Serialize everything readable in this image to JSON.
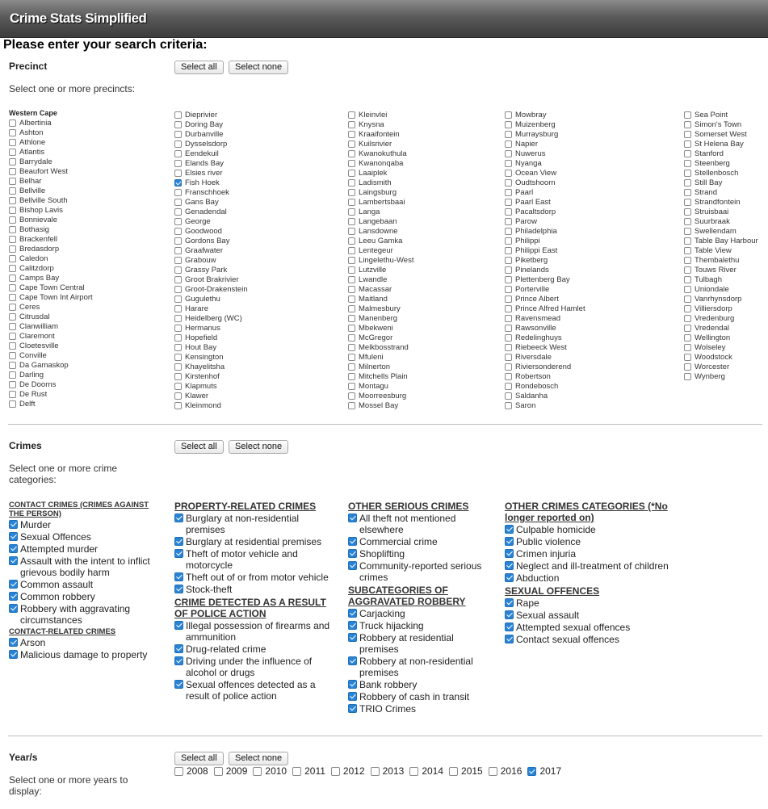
{
  "header": {
    "title": "Crime Stats Simplified"
  },
  "subtitle": "Please enter your search criteria:",
  "precinct": {
    "label": "Precinct",
    "select_all": "Select all",
    "select_none": "Select none",
    "description": "Select one or more precincts:",
    "group_title": "Western Cape",
    "columns": [
      [
        {
          "name": "Albertinia",
          "checked": false
        },
        {
          "name": "Ashton",
          "checked": false
        },
        {
          "name": "Athlone",
          "checked": false
        },
        {
          "name": "Atlantis",
          "checked": false
        },
        {
          "name": "Barrydale",
          "checked": false
        },
        {
          "name": "Beaufort West",
          "checked": false
        },
        {
          "name": "Belhar",
          "checked": false
        },
        {
          "name": "Bellville",
          "checked": false
        },
        {
          "name": "Bellville South",
          "checked": false
        },
        {
          "name": "Bishop Lavis",
          "checked": false
        },
        {
          "name": "Bonnievale",
          "checked": false
        },
        {
          "name": "Bothasig",
          "checked": false
        },
        {
          "name": "Brackenfell",
          "checked": false
        },
        {
          "name": "Bredasdorp",
          "checked": false
        },
        {
          "name": "Caledon",
          "checked": false
        },
        {
          "name": "Calitzdorp",
          "checked": false
        },
        {
          "name": "Camps Bay",
          "checked": false
        },
        {
          "name": "Cape Town Central",
          "checked": false
        },
        {
          "name": "Cape Town Int Airport",
          "checked": false
        },
        {
          "name": "Ceres",
          "checked": false
        },
        {
          "name": "Citrusdal",
          "checked": false
        },
        {
          "name": "Clanwilliam",
          "checked": false
        },
        {
          "name": "Claremont",
          "checked": false
        },
        {
          "name": "Cloetesville",
          "checked": false
        },
        {
          "name": "Conville",
          "checked": false
        },
        {
          "name": "Da Gamaskop",
          "checked": false
        },
        {
          "name": "Darling",
          "checked": false
        },
        {
          "name": "De Doorns",
          "checked": false
        },
        {
          "name": "De Rust",
          "checked": false
        },
        {
          "name": "Delft",
          "checked": false
        }
      ],
      [
        {
          "name": "Dieprivier",
          "checked": false
        },
        {
          "name": "Doring Bay",
          "checked": false
        },
        {
          "name": "Durbanville",
          "checked": false
        },
        {
          "name": "Dysselsdorp",
          "checked": false
        },
        {
          "name": "Eendekuil",
          "checked": false
        },
        {
          "name": "Elands Bay",
          "checked": false
        },
        {
          "name": "Elsies river",
          "checked": false
        },
        {
          "name": "Fish Hoek",
          "checked": true
        },
        {
          "name": "Franschhoek",
          "checked": false
        },
        {
          "name": "Gans Bay",
          "checked": false
        },
        {
          "name": "Genadendal",
          "checked": false
        },
        {
          "name": "George",
          "checked": false
        },
        {
          "name": "Goodwood",
          "checked": false
        },
        {
          "name": "Gordons Bay",
          "checked": false
        },
        {
          "name": "Graafwater",
          "checked": false
        },
        {
          "name": "Grabouw",
          "checked": false
        },
        {
          "name": "Grassy Park",
          "checked": false
        },
        {
          "name": "Groot Brakrivier",
          "checked": false
        },
        {
          "name": "Groot-Drakenstein",
          "checked": false
        },
        {
          "name": "Gugulethu",
          "checked": false
        },
        {
          "name": "Harare",
          "checked": false
        },
        {
          "name": "Heidelberg (WC)",
          "checked": false
        },
        {
          "name": "Hermanus",
          "checked": false
        },
        {
          "name": "Hopefield",
          "checked": false
        },
        {
          "name": "Hout Bay",
          "checked": false
        },
        {
          "name": "Kensington",
          "checked": false
        },
        {
          "name": "Khayelitsha",
          "checked": false
        },
        {
          "name": "Kirstenhof",
          "checked": false
        },
        {
          "name": "Klapmuts",
          "checked": false
        },
        {
          "name": "Klawer",
          "checked": false
        },
        {
          "name": "Kleinmond",
          "checked": false
        }
      ],
      [
        {
          "name": "Kleinvlei",
          "checked": false
        },
        {
          "name": "Knysna",
          "checked": false
        },
        {
          "name": "Kraaifontein",
          "checked": false
        },
        {
          "name": "Kuilsrivier",
          "checked": false
        },
        {
          "name": "Kwanokuthula",
          "checked": false
        },
        {
          "name": "Kwanonqaba",
          "checked": false
        },
        {
          "name": "Laaiplek",
          "checked": false
        },
        {
          "name": "Ladismith",
          "checked": false
        },
        {
          "name": "Laingsburg",
          "checked": false
        },
        {
          "name": "Lambertsbaai",
          "checked": false
        },
        {
          "name": "Langa",
          "checked": false
        },
        {
          "name": "Langebaan",
          "checked": false
        },
        {
          "name": "Lansdowne",
          "checked": false
        },
        {
          "name": "Leeu Gamka",
          "checked": false
        },
        {
          "name": "Lentegeur",
          "checked": false
        },
        {
          "name": "Lingelethu-West",
          "checked": false
        },
        {
          "name": "Lutzville",
          "checked": false
        },
        {
          "name": "Lwandle",
          "checked": false
        },
        {
          "name": "Macassar",
          "checked": false
        },
        {
          "name": "Maitland",
          "checked": false
        },
        {
          "name": "Malmesbury",
          "checked": false
        },
        {
          "name": "Manenberg",
          "checked": false
        },
        {
          "name": "Mbekweni",
          "checked": false
        },
        {
          "name": "McGregor",
          "checked": false
        },
        {
          "name": "Melkbosstrand",
          "checked": false
        },
        {
          "name": "Mfuleni",
          "checked": false
        },
        {
          "name": "Milnerton",
          "checked": false
        },
        {
          "name": "Mitchells Plain",
          "checked": false
        },
        {
          "name": "Montagu",
          "checked": false
        },
        {
          "name": "Moorreesburg",
          "checked": false
        },
        {
          "name": "Mossel Bay",
          "checked": false
        }
      ],
      [
        {
          "name": "Mowbray",
          "checked": false
        },
        {
          "name": "Muizenberg",
          "checked": false
        },
        {
          "name": "Murraysburg",
          "checked": false
        },
        {
          "name": "Napier",
          "checked": false
        },
        {
          "name": "Nuwerus",
          "checked": false
        },
        {
          "name": "Nyanga",
          "checked": false
        },
        {
          "name": "Ocean View",
          "checked": false
        },
        {
          "name": "Oudtshoorn",
          "checked": false
        },
        {
          "name": "Paarl",
          "checked": false
        },
        {
          "name": "Paarl East",
          "checked": false
        },
        {
          "name": "Pacaltsdorp",
          "checked": false
        },
        {
          "name": "Parow",
          "checked": false
        },
        {
          "name": "Philadelphia",
          "checked": false
        },
        {
          "name": "Philippi",
          "checked": false
        },
        {
          "name": "Philippi East",
          "checked": false
        },
        {
          "name": "Piketberg",
          "checked": false
        },
        {
          "name": "Pinelands",
          "checked": false
        },
        {
          "name": "Plettenberg Bay",
          "checked": false
        },
        {
          "name": "Porterville",
          "checked": false
        },
        {
          "name": "Prince Albert",
          "checked": false
        },
        {
          "name": "Prince Alfred Hamlet",
          "checked": false
        },
        {
          "name": "Ravensmead",
          "checked": false
        },
        {
          "name": "Rawsonville",
          "checked": false
        },
        {
          "name": "Redelinghuys",
          "checked": false
        },
        {
          "name": "Riebeeck West",
          "checked": false
        },
        {
          "name": "Riversdale",
          "checked": false
        },
        {
          "name": "Riviersonderend",
          "checked": false
        },
        {
          "name": "Robertson",
          "checked": false
        },
        {
          "name": "Rondebosch",
          "checked": false
        },
        {
          "name": "Saldanha",
          "checked": false
        },
        {
          "name": "Saron",
          "checked": false
        }
      ],
      [
        {
          "name": "Sea Point",
          "checked": false
        },
        {
          "name": "Simon's Town",
          "checked": false
        },
        {
          "name": "Somerset West",
          "checked": false
        },
        {
          "name": "St Helena Bay",
          "checked": false
        },
        {
          "name": "Stanford",
          "checked": false
        },
        {
          "name": "Steenberg",
          "checked": false
        },
        {
          "name": "Stellenbosch",
          "checked": false
        },
        {
          "name": "Still Bay",
          "checked": false
        },
        {
          "name": "Strand",
          "checked": false
        },
        {
          "name": "Strandfontein",
          "checked": false
        },
        {
          "name": "Struisbaai",
          "checked": false
        },
        {
          "name": "Suurbraak",
          "checked": false
        },
        {
          "name": "Swellendam",
          "checked": false
        },
        {
          "name": "Table Bay Harbour",
          "checked": false
        },
        {
          "name": "Table View",
          "checked": false
        },
        {
          "name": "Thembalethu",
          "checked": false
        },
        {
          "name": "Touws River",
          "checked": false
        },
        {
          "name": "Tulbagh",
          "checked": false
        },
        {
          "name": "Uniondale",
          "checked": false
        },
        {
          "name": "Vanrhynsdorp",
          "checked": false
        },
        {
          "name": "Villiersdorp",
          "checked": false
        },
        {
          "name": "Vredenburg",
          "checked": false
        },
        {
          "name": "Vredendal",
          "checked": false
        },
        {
          "name": "Wellington",
          "checked": false
        },
        {
          "name": "Wolseley",
          "checked": false
        },
        {
          "name": "Woodstock",
          "checked": false
        },
        {
          "name": "Worcester",
          "checked": false
        },
        {
          "name": "Wynberg",
          "checked": false
        }
      ]
    ]
  },
  "crimes": {
    "label": "Crimes",
    "select_all": "Select all",
    "select_none": "Select none",
    "description": "Select one or more crime categories:",
    "columns": [
      [
        {
          "heading": "CONTACT CRIMES (CRIMES AGAINST THE PERSON)",
          "small": true,
          "items": [
            "Murder",
            "Sexual Offences",
            "Attempted murder",
            "Assault with the intent to inflict grievous bodily harm",
            "Common assault",
            "Common robbery",
            "Robbery with aggravating circumstances"
          ]
        },
        {
          "heading": "CONTACT-RELATED CRIMES",
          "small": true,
          "items": [
            "Arson",
            "Malicious damage to property"
          ]
        }
      ],
      [
        {
          "heading": "PROPERTY-RELATED CRIMES",
          "small": false,
          "items": [
            "Burglary at non-residential premises",
            "Burglary at residential premises",
            "Theft of motor vehicle and motorcycle",
            "Theft out of or from motor vehicle",
            "Stock-theft"
          ]
        },
        {
          "heading": "CRIME DETECTED AS A RESULT OF POLICE ACTION",
          "small": false,
          "items": [
            "Illegal possession of firearms and ammunition",
            "Drug-related crime",
            "Driving under the influence of alcohol or drugs",
            "Sexual offences detected as a result of police action"
          ]
        }
      ],
      [
        {
          "heading": "OTHER SERIOUS CRIMES",
          "small": false,
          "items": [
            "All theft not mentioned elsewhere",
            "Commercial crime",
            "Shoplifting",
            "Community-reported serious crimes"
          ]
        },
        {
          "heading": "SUBCATEGORIES OF AGGRAVATED ROBBERY",
          "small": false,
          "items": [
            "Carjacking",
            "Truck hijacking",
            "Robbery at residential premises",
            "Robbery at non-residential premises",
            "Bank robbery",
            "Robbery of cash in transit",
            "TRIO Crimes"
          ]
        }
      ],
      [
        {
          "heading": "OTHER CRIMES CATEGORIES (*No longer reported on)",
          "small": false,
          "items": [
            "Culpable homicide",
            "Public violence",
            "Crimen injuria",
            "Neglect and ill-treatment of children",
            "Abduction"
          ]
        },
        {
          "heading": "SEXUAL OFFENCES",
          "small": false,
          "items": [
            "Rape",
            "Sexual assault",
            "Attempted sexual offences",
            "Contact sexual offences"
          ]
        }
      ]
    ]
  },
  "years": {
    "label": "Year/s",
    "select_all": "Select all",
    "select_none": "Select none",
    "description": "Select one or more years to display:",
    "items": [
      {
        "year": "2008",
        "checked": false
      },
      {
        "year": "2009",
        "checked": false
      },
      {
        "year": "2010",
        "checked": false
      },
      {
        "year": "2011",
        "checked": false
      },
      {
        "year": "2012",
        "checked": false
      },
      {
        "year": "2013",
        "checked": false
      },
      {
        "year": "2014",
        "checked": false
      },
      {
        "year": "2015",
        "checked": false
      },
      {
        "year": "2016",
        "checked": false
      },
      {
        "year": "2017",
        "checked": true
      }
    ]
  },
  "colors": {
    "accent": "#2a84d6",
    "header_bg": "#4a4a4a"
  }
}
